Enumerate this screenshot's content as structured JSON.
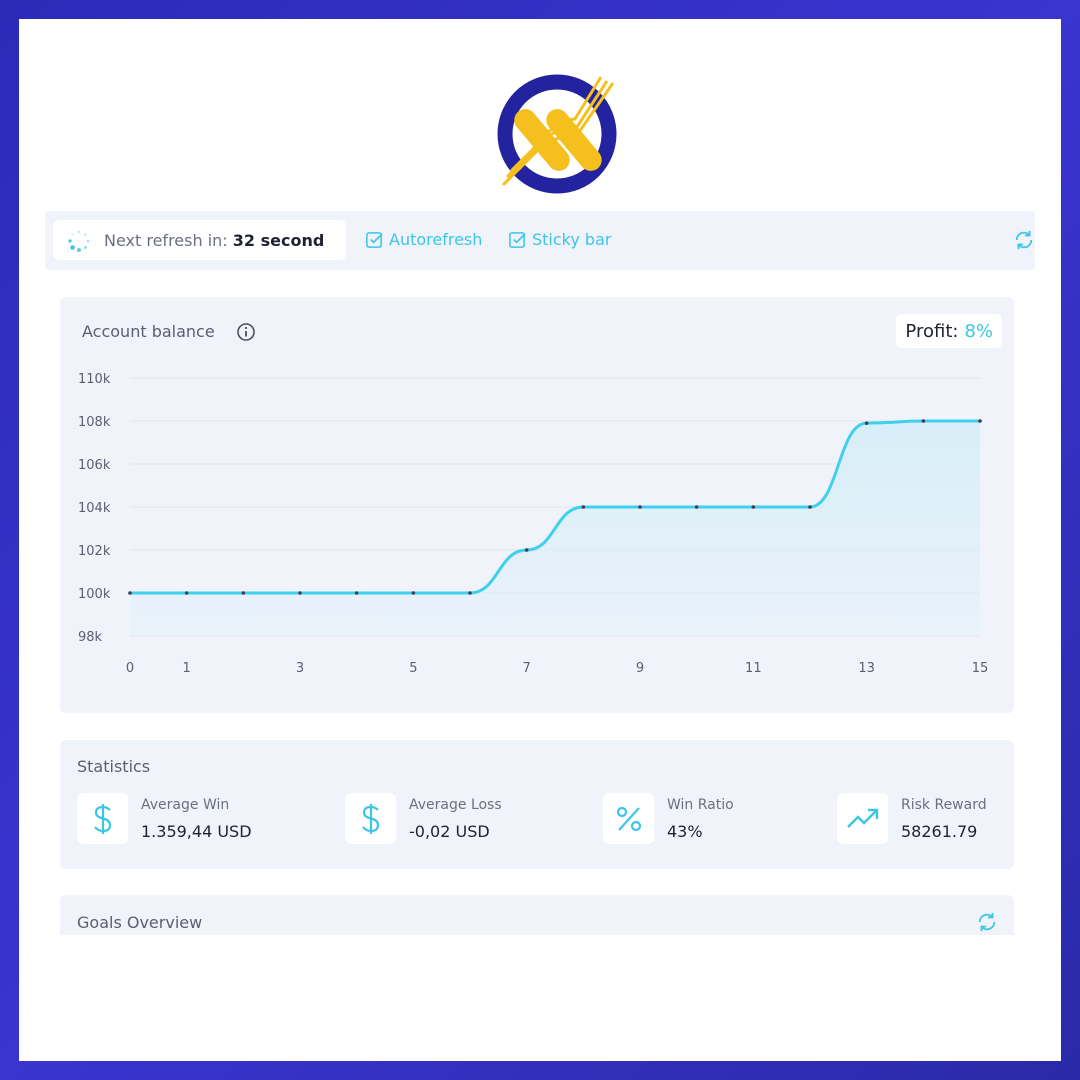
{
  "logo": {
    "name": "x-ring-logo",
    "colors": {
      "ring": "#2424a6",
      "x": "#f5bf1d"
    }
  },
  "topbar": {
    "refresh_label": "Next refresh in:",
    "refresh_value": "32 second",
    "autorefresh_label": "Autorefresh",
    "autorefresh_checked": true,
    "sticky_label": "Sticky bar",
    "sticky_checked": true,
    "refresh_icon": "refresh-icon"
  },
  "balance": {
    "title": "Account balance",
    "info_icon": "info-icon",
    "profit_label": "Profit:",
    "profit_value": "8%"
  },
  "chart_data": {
    "type": "area",
    "title": "Account balance",
    "x": [
      0,
      1,
      2,
      3,
      4,
      5,
      6,
      7,
      8,
      9,
      10,
      11,
      12,
      13,
      14,
      15
    ],
    "series": [
      {
        "values": [
          100000,
          100000,
          100000,
          100000,
          100000,
          100000,
          100000,
          102000,
          104000,
          104000,
          104000,
          104000,
          104000,
          107900,
          108000,
          108000
        ]
      }
    ],
    "x_ticks": [
      "0",
      "1",
      "3",
      "5",
      "7",
      "9",
      "11",
      "13",
      "15"
    ],
    "x_tick_values": [
      0,
      1,
      3,
      5,
      7,
      9,
      11,
      13,
      15
    ],
    "y_ticks": [
      "98k",
      "100k",
      "102k",
      "104k",
      "106k",
      "108k",
      "110k"
    ],
    "y_tick_values": [
      98000,
      100000,
      102000,
      104000,
      106000,
      108000,
      110000
    ],
    "ylim": [
      98000,
      110000
    ],
    "xlim": [
      0,
      15
    ],
    "grid": true,
    "colors": {
      "line": "#3fd0ee",
      "fill": "#d6eef8"
    }
  },
  "stats": {
    "title": "Statistics",
    "items": [
      {
        "label": "Average Win",
        "value": "1.359,44 USD",
        "icon": "dollar-icon"
      },
      {
        "label": "Average Loss",
        "value": "-0,02 USD",
        "icon": "dollar-icon"
      },
      {
        "label": "Win Ratio",
        "value": "43%",
        "icon": "percent-icon"
      },
      {
        "label": "Risk Reward",
        "value": "58261.79",
        "icon": "trending-up-icon"
      }
    ]
  },
  "goals": {
    "title": "Goals Overview",
    "refresh_icon": "refresh-icon"
  },
  "colors": {
    "accent": "#3bc6e6",
    "card_bg": "#f1f3fa",
    "frame": "#3030c0"
  }
}
